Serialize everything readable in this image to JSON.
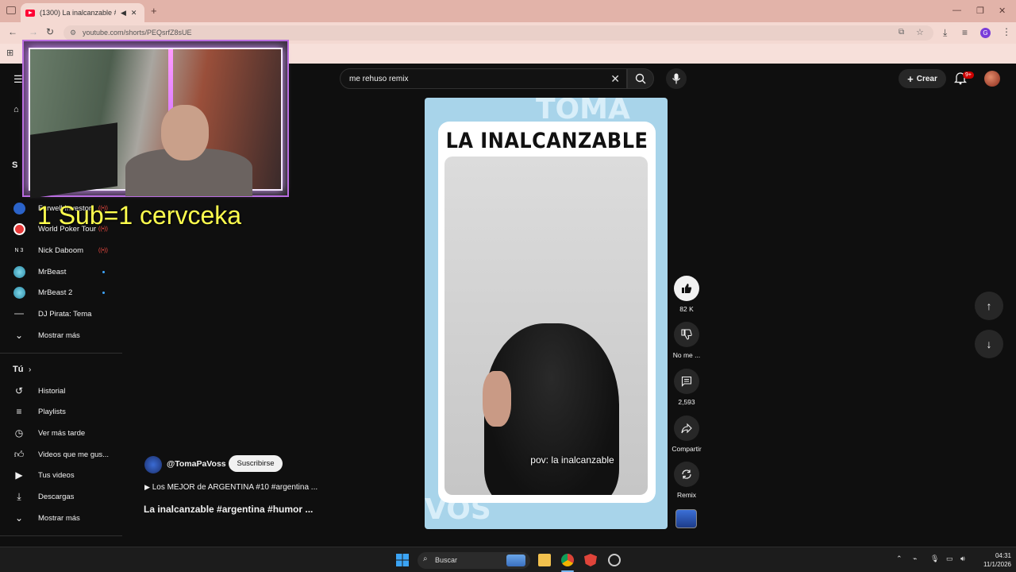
{
  "browser": {
    "tab_title": "(1300) La inalcanzable #arg",
    "new_tab": "+",
    "url": "youtube.com/shorts/PEQsrfZ8sUE"
  },
  "youtube": {
    "search_value": "me rehuso remix",
    "create_label": "Crear",
    "notifications_badge": "9+"
  },
  "sidebar": {
    "subscriptions_header": "S",
    "subscriptions": [
      {
        "label": "Farwell Investor",
        "status": "live"
      },
      {
        "label": "World Poker Tour",
        "status": "live"
      },
      {
        "label": "Nick Daboom",
        "status": "live",
        "avatar_text": "N 3"
      },
      {
        "label": "MrBeast",
        "status": "new"
      },
      {
        "label": "MrBeast 2",
        "status": "new"
      },
      {
        "label": "DJ Pirata: Tema",
        "status": ""
      },
      {
        "label": "Mostrar más",
        "status": ""
      }
    ],
    "you_header": "Tú",
    "you_items": [
      {
        "label": "Historial",
        "icon": "history-icon"
      },
      {
        "label": "Playlists",
        "icon": "playlists-icon"
      },
      {
        "label": "Ver más tarde",
        "icon": "clock-icon"
      },
      {
        "label": "Videos que me gus...",
        "icon": "thumbs-up-icon"
      },
      {
        "label": "Tus videos",
        "icon": "video-icon"
      },
      {
        "label": "Descargas",
        "icon": "download-icon"
      },
      {
        "label": "Mostrar más",
        "icon": "chevron-down-icon"
      }
    ]
  },
  "overlay": {
    "sub_text": "1 Sub=1 cervceka"
  },
  "short": {
    "watermark_top": "TOMA",
    "watermark_bottom": "VOS",
    "card_title": "LA INALCANZABLE",
    "caption": "pov: la inalcanzable",
    "channel": "@TomaPaVoss",
    "subscribe_label": "Suscribirse",
    "playlist": "Los MEJOR de ARGENTINA #10 #argentina ...",
    "title": "La inalcanzable #argentina #humor ...",
    "likes": "82 K",
    "dislike_label": "No me ...",
    "comments": "2,593",
    "share_label": "Compartir",
    "remix_label": "Remix"
  },
  "taskbar": {
    "search_placeholder": "Buscar",
    "time": "04:31",
    "date": "11/1/2026"
  },
  "colors": {
    "yt_bg": "#0f0f0f",
    "yt_red": "#ff0033",
    "chrome_frame": "#e2b3a9",
    "short_bg": "#a8d4ea",
    "overlay_text": "#ffff4d"
  }
}
